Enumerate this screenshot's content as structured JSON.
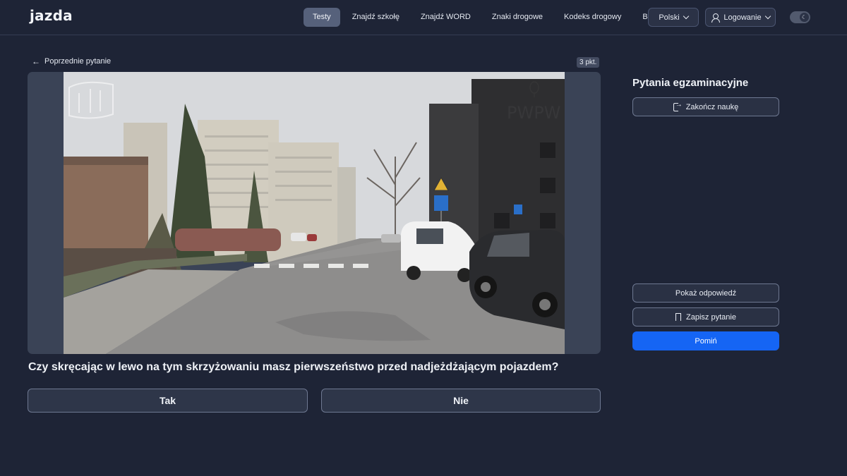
{
  "app": {
    "logo": "jazda"
  },
  "nav": {
    "items": [
      "Testy",
      "Znajdź szkołę",
      "Znajdź WORD",
      "Znaki drogowe",
      "Kodeks drogowy",
      "Blog"
    ],
    "active": "Testy",
    "language": "Polski",
    "login": "Logowanie",
    "theme_icon": "moon-icon"
  },
  "question": {
    "back_label": "Poprzednie pytanie",
    "points": "3 pkt.",
    "text": "Czy skręcając w lewo na tym skrzyżowaniu masz pierwszeństwo przed nadjeżdżającym pojazdem?",
    "answers": [
      "Tak",
      "Nie"
    ],
    "media_watermark": "PWPW"
  },
  "sidebar": {
    "title": "Pytania egzaminacyjne",
    "end_label": "Zakończ naukę",
    "show_answer_label": "Pokaż odpowiedź",
    "save_label": "Zapisz pytanie",
    "skip_label": "Pomiń"
  },
  "colors": {
    "background": "#1e2436",
    "primary": "#1565f4",
    "active_nav": "#56617b"
  }
}
